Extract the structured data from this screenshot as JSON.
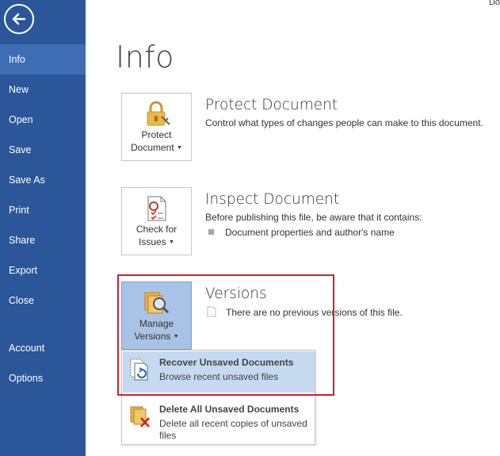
{
  "corner_text": "Do",
  "sidebar": {
    "items": [
      {
        "label": "Info",
        "selected": true
      },
      {
        "label": "New"
      },
      {
        "label": "Open"
      },
      {
        "label": "Save"
      },
      {
        "label": "Save As"
      },
      {
        "label": "Print"
      },
      {
        "label": "Share"
      },
      {
        "label": "Export"
      },
      {
        "label": "Close"
      },
      {
        "label": "Account"
      },
      {
        "label": "Options"
      }
    ]
  },
  "main": {
    "title": "Info",
    "protect": {
      "button_line1": "Protect",
      "button_line2": "Document",
      "title": "Protect Document",
      "description": "Control what types of changes people can make to this document."
    },
    "inspect": {
      "button_line1": "Check for",
      "button_line2": "Issues",
      "title": "Inspect Document",
      "description": "Before publishing this file, be aware that it contains:",
      "bullet": "Document properties and author's name"
    },
    "versions": {
      "button_line1": "Manage",
      "button_line2": "Versions",
      "title": "Versions",
      "description": "There are no previous versions of this file."
    },
    "dropdown": {
      "items": [
        {
          "title": "Recover Unsaved Documents",
          "description": "Browse recent unsaved files"
        },
        {
          "title": "Delete All Unsaved Documents",
          "description": "Delete all recent copies of unsaved files"
        }
      ]
    }
  },
  "colors": {
    "sidebar": "#2b579a",
    "sidebar_selected": "#3e6db5",
    "highlight_border": "#d51f26",
    "active_tile": "#a9c3e6",
    "dropdown_hover": "#c5d9f1"
  }
}
